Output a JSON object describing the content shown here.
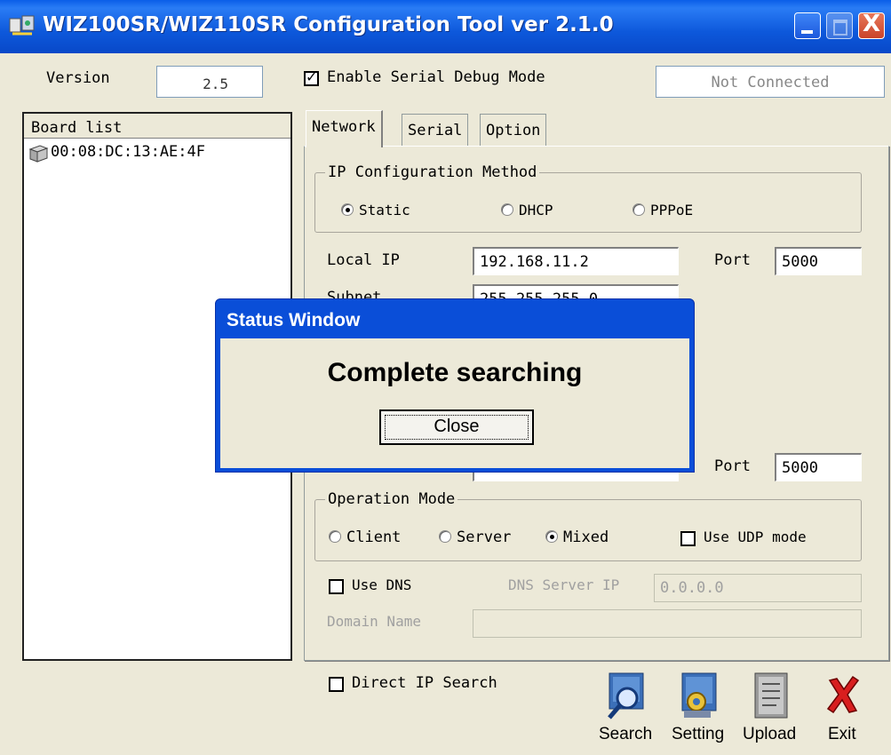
{
  "window": {
    "title": "WIZ100SR/WIZ110SR Configuration Tool ver 2.1.0",
    "close_glyph": "X"
  },
  "header": {
    "version_label": "Version",
    "version_value": "2.5",
    "debug_checkbox_label": "Enable Serial Debug Mode",
    "debug_checked": true,
    "status_text": "Not Connected"
  },
  "board_list": {
    "header": "Board list",
    "items": [
      "00:08:DC:13:AE:4F"
    ]
  },
  "tabs": [
    {
      "label": "Network"
    },
    {
      "label": "Serial"
    },
    {
      "label": "Option"
    }
  ],
  "ip_method": {
    "title": "IP Configuration Method",
    "options": [
      "Static",
      "DHCP",
      "PPPoE"
    ],
    "selected": "Static"
  },
  "network": {
    "local_ip_label": "Local IP",
    "local_ip_value": "192.168.11.2",
    "port_label": "Port",
    "local_port_value": "5000",
    "subnet_label": "Subnet",
    "subnet_value": "255.255.255.0",
    "remote_port_label": "Port",
    "remote_port_value": "5000"
  },
  "operation_mode": {
    "title": "Operation Mode",
    "options": [
      "Client",
      "Server",
      "Mixed"
    ],
    "selected": "Mixed",
    "udp_label": "Use UDP mode",
    "udp_checked": false
  },
  "dns": {
    "use_dns_label": "Use DNS",
    "use_dns_checked": false,
    "server_ip_label": "DNS Server IP",
    "server_ip_value": "0.0.0.0",
    "domain_name_label": "Domain Name",
    "domain_name_value": ""
  },
  "footer": {
    "direct_ip_label": "Direct IP Search",
    "direct_ip_checked": false,
    "buttons": [
      {
        "label": "Search",
        "icon": "search-icon"
      },
      {
        "label": "Setting",
        "icon": "settings-icon"
      },
      {
        "label": "Upload",
        "icon": "upload-icon"
      },
      {
        "label": "Exit",
        "icon": "exit-icon"
      }
    ]
  },
  "status_window": {
    "title": "Status Window",
    "message": "Complete searching",
    "close_label": "Close"
  },
  "colors": {
    "titlebar": "#0d58db",
    "dialog_bg": "#ece9d8",
    "field_border": "#7f9db9"
  }
}
